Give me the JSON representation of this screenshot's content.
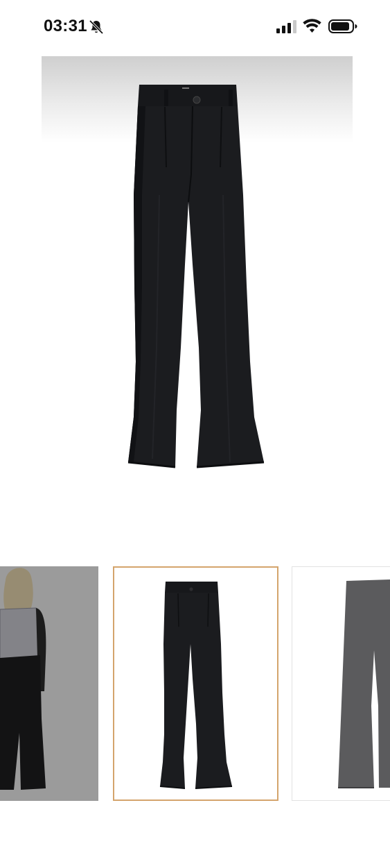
{
  "status_bar": {
    "time": "03:31",
    "icons": [
      "bell-slash-icon",
      "cellular-signal-icon",
      "wifi-icon",
      "battery-icon"
    ]
  },
  "product": {
    "main_image": "black-wide-leg-trousers",
    "thumbnails": [
      {
        "image": "model-back-view",
        "selected": false
      },
      {
        "image": "black-wide-leg-trousers",
        "selected": true
      },
      {
        "image": "trousers-side-view",
        "selected": false
      }
    ]
  },
  "colors": {
    "selected_border": "#d4a46c",
    "fabric": "#1b1c1f",
    "dimmed_overlay": "rgba(0,0,0,0.35)"
  }
}
